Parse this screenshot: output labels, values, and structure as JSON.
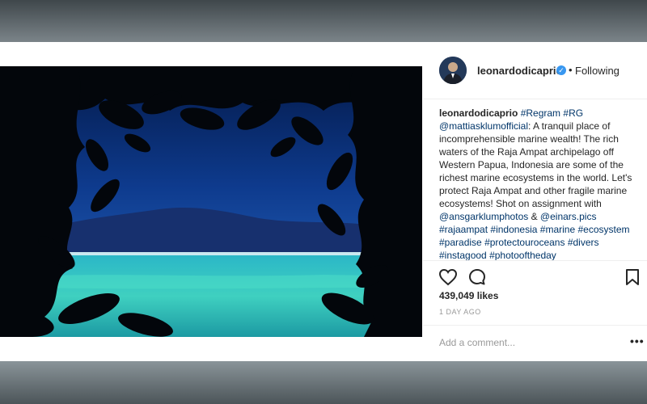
{
  "post": {
    "username": "leonardodicaprio",
    "follow_separator": "•",
    "follow_status": "Following",
    "verified_icon": "verified-badge-icon",
    "caption": {
      "username": "leonardodicaprio",
      "tag1": "#Regram",
      "tag2": "#RG",
      "mention1": "@mattiasklumofficial",
      "text1": ": A tranquil place of incomprehensible marine wealth! The rich waters of the Raja Ampat archipelago off Western Papua, Indonesia are some of the richest marine ecosystems in the world. Let's protect Raja Ampat and other fragile marine ecosystems! Shot on assignment with ",
      "mention2": "@ansgarklumphotos",
      "text2": " & ",
      "mention3": "@einars.pics",
      "hashtags": [
        "#rajaampat",
        "#indonesia",
        "#marine",
        "#ecosystem",
        "#paradise",
        "#protectouroceans",
        "#divers",
        "#instagood",
        "#photooftheday"
      ]
    },
    "likes": "439,049 likes",
    "time_ago": "1 DAY AGO",
    "comment_placeholder": "Add a comment...",
    "more_options": "•••"
  },
  "icons": {
    "like": "heart-icon",
    "comment": "comment-bubble-icon",
    "save": "bookmark-icon",
    "more": "more-options-icon"
  },
  "colors": {
    "link": "#003569",
    "verified": "#3897f0",
    "text": "#262626",
    "muted": "#999999"
  }
}
